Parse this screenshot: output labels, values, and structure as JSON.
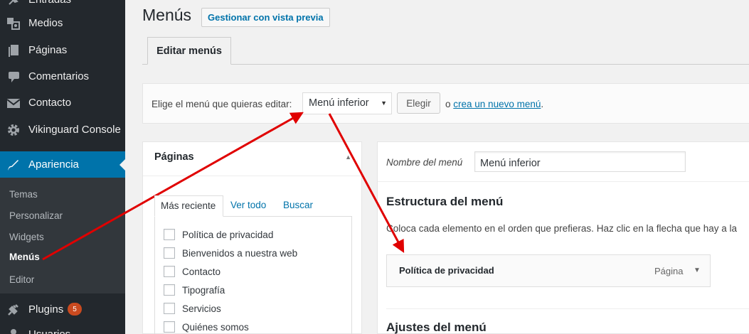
{
  "sidebar": {
    "items": [
      {
        "label": "Entradas",
        "icon": "pin-icon"
      },
      {
        "label": "Medios",
        "icon": "media-icon"
      },
      {
        "label": "Páginas",
        "icon": "pages-icon"
      },
      {
        "label": "Comentarios",
        "icon": "comments-icon"
      },
      {
        "label": "Contacto",
        "icon": "mail-icon"
      },
      {
        "label": "Vikinguard Console",
        "icon": "gear-icon"
      },
      {
        "label": "Apariencia",
        "icon": "brush-icon"
      },
      {
        "label": "Plugins",
        "icon": "plugin-icon",
        "badge": "5"
      },
      {
        "label": "Usuarios",
        "icon": "users-icon"
      }
    ],
    "submenu": [
      "Temas",
      "Personalizar",
      "Widgets",
      "Menús",
      "Editor"
    ],
    "colors": {
      "bg": "#23282d",
      "active": "#0073aa",
      "badge": "#ca4a1f"
    }
  },
  "header": {
    "title": "Menús",
    "preview_button": "Gestionar con vista previa",
    "tab": "Editar menús"
  },
  "manage": {
    "label": "Elige el menú que quieras editar:",
    "selected_menu": "Menú inferior",
    "choose_button": "Elegir",
    "or_text": "o",
    "create_link": "crea un nuevo menú",
    "period": "."
  },
  "pages_panel": {
    "title": "Páginas",
    "tabs": [
      "Más reciente",
      "Ver todo",
      "Buscar"
    ],
    "items": [
      "Política de privacidad",
      "Bienvenidos a nuestra web",
      "Contacto",
      "Tipografía",
      "Servicios",
      "Quiénes somos"
    ]
  },
  "menu_panel": {
    "name_label": "Nombre del menú",
    "name_value": "Menú inferior",
    "structure_title": "Estructura del menú",
    "structure_desc": "Coloca cada elemento en el orden que prefieras. Haz clic en la flecha que hay a la",
    "item": {
      "title": "Política de privacidad",
      "type": "Página"
    },
    "settings_title": "Ajustes del menú"
  },
  "annotation_color": "#e00000"
}
